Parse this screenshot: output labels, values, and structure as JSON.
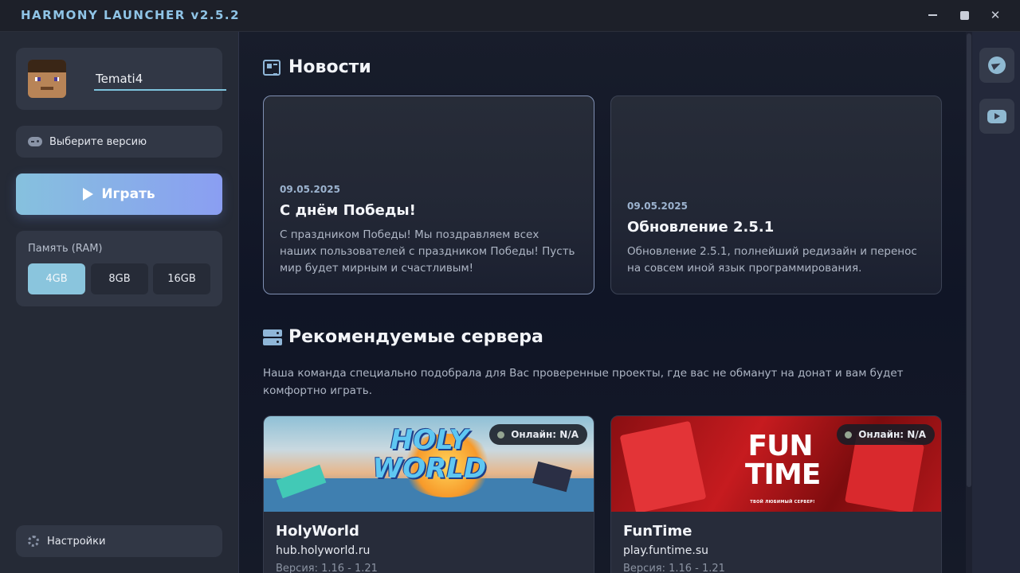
{
  "window": {
    "title": "HARMONY LAUNCHER v2.5.2",
    "controls": {
      "minimize": "minimize",
      "maximize": "maximize",
      "close": "✕"
    }
  },
  "sidebar": {
    "username": "Temati4",
    "version_label": "Выберите версию",
    "play_label": "Играть",
    "ram": {
      "title": "Память (RAM)",
      "options": [
        "4GB",
        "8GB",
        "16GB"
      ],
      "selected": "4GB"
    },
    "settings_label": "Настройки"
  },
  "news": {
    "title": "Новости",
    "items": [
      {
        "date": "09.05.2025",
        "headline": "С днём Победы!",
        "body": "С праздником Победы! Мы поздравляем всех наших пользователей с праздником Победы! Пусть мир будет мирным и счастливым!"
      },
      {
        "date": "09.05.2025",
        "headline": "Обновление 2.5.1",
        "body": "Обновление 2.5.1, полнейший редизайн и перенос на совсем иной язык программирования."
      }
    ]
  },
  "servers": {
    "title": "Рекомендуемые сервера",
    "description": "Наша команда специально подобрала для Вас проверенные проекты, где вас не обманут на донат и вам будет комфортно играть.",
    "items": [
      {
        "name": "HolyWorld",
        "host": "hub.holyworld.ru",
        "version": "Версия: 1.16 - 1.21",
        "online": "Онлайн: N/A",
        "banner_logo": "HOLY WORLD"
      },
      {
        "name": "FunTime",
        "host": "play.funtime.su",
        "version": "Версия: 1.16 - 1.21",
        "online": "Онлайн: N/A",
        "banner_logo": "FUN TIME",
        "banner_tagline": "ТВОЙ ЛЮБИМЫЙ СЕРВЕР!"
      }
    ]
  },
  "social": {
    "links": [
      "telegram-icon",
      "youtube-icon"
    ]
  },
  "colors": {
    "accent": "#86c1de",
    "accent_end": "#8a9ef2",
    "sidebar_bg": "#252a36",
    "panel_bg": "#313745",
    "ram_selected": "#8ac5dd"
  }
}
